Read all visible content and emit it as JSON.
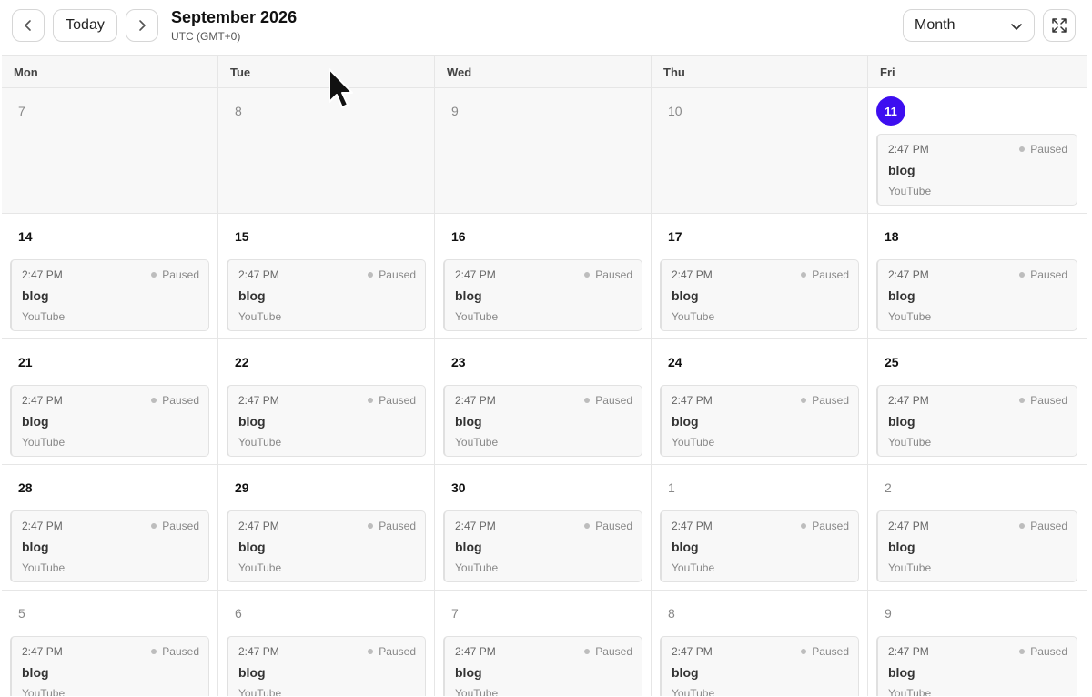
{
  "header": {
    "today_label": "Today",
    "title": "September 2026",
    "subtitle": "UTC (GMT+0)",
    "view_selected": "Month"
  },
  "weekdays": [
    "Mon",
    "Tue",
    "Wed",
    "Thu",
    "Fri"
  ],
  "colors": {
    "today_accent": "#3d0ef0"
  },
  "event_template": {
    "time": "2:47 PM",
    "status": "Paused",
    "name": "blog",
    "platform": "YouTube"
  },
  "weeks": [
    {
      "days": [
        {
          "num": "7",
          "muted": true,
          "event": false
        },
        {
          "num": "8",
          "muted": true,
          "event": false
        },
        {
          "num": "9",
          "muted": true,
          "event": false
        },
        {
          "num": "10",
          "muted": true,
          "event": false
        },
        {
          "num": "11",
          "today": true,
          "event": true
        }
      ]
    },
    {
      "days": [
        {
          "num": "14",
          "event": true
        },
        {
          "num": "15",
          "event": true
        },
        {
          "num": "16",
          "event": true
        },
        {
          "num": "17",
          "event": true
        },
        {
          "num": "18",
          "event": true
        }
      ]
    },
    {
      "days": [
        {
          "num": "21",
          "event": true
        },
        {
          "num": "22",
          "event": true
        },
        {
          "num": "23",
          "event": true
        },
        {
          "num": "24",
          "event": true
        },
        {
          "num": "25",
          "event": true
        }
      ]
    },
    {
      "days": [
        {
          "num": "28",
          "event": true
        },
        {
          "num": "29",
          "event": true
        },
        {
          "num": "30",
          "event": true
        },
        {
          "num": "1",
          "muted": true,
          "event": true
        },
        {
          "num": "2",
          "muted": true,
          "event": true
        }
      ]
    },
    {
      "days": [
        {
          "num": "5",
          "muted": true,
          "event": true
        },
        {
          "num": "6",
          "muted": true,
          "event": true
        },
        {
          "num": "7",
          "muted": true,
          "event": true
        },
        {
          "num": "8",
          "muted": true,
          "event": true
        },
        {
          "num": "9",
          "muted": true,
          "event": true
        }
      ]
    }
  ]
}
